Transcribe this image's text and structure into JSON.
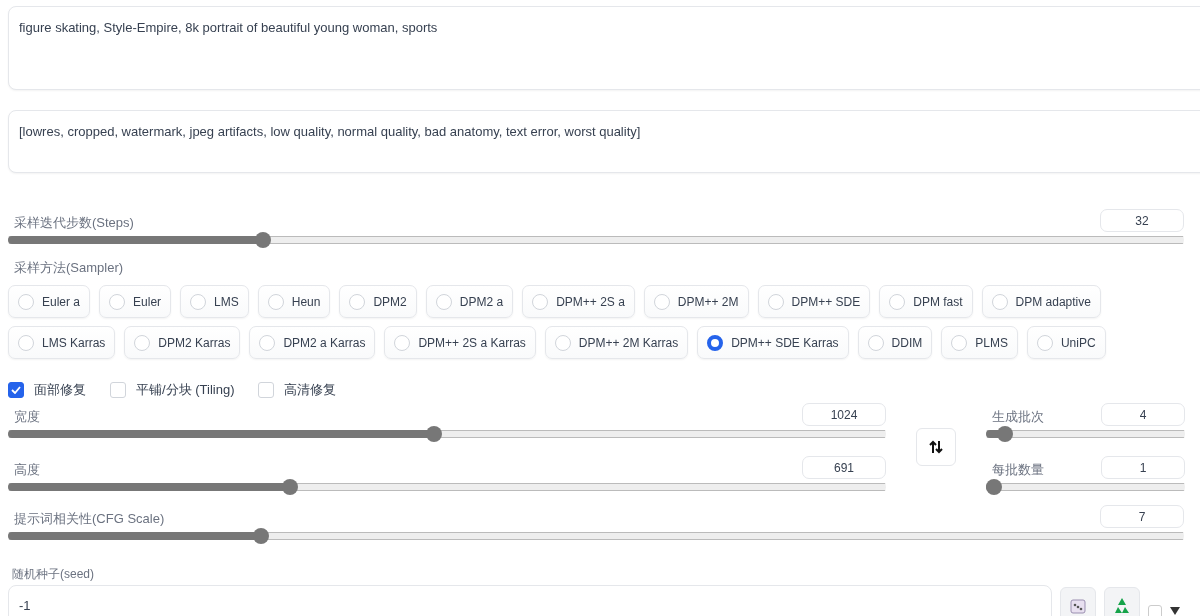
{
  "prompt": {
    "value": "figure skating, Style-Empire, 8k portrait of beautiful young woman, sports"
  },
  "negative_prompt": {
    "value": "[lowres, cropped, watermark, jpeg artifacts, low quality, normal quality, bad anatomy, text error, worst quality]"
  },
  "steps": {
    "label": "采样迭代步数(Steps)",
    "value": "32",
    "level": 0.213
  },
  "sampler": {
    "label": "采样方法(Sampler)",
    "options": [
      {
        "label": "Euler a",
        "selected": false
      },
      {
        "label": "Euler",
        "selected": false
      },
      {
        "label": "LMS",
        "selected": false
      },
      {
        "label": "Heun",
        "selected": false
      },
      {
        "label": "DPM2",
        "selected": false
      },
      {
        "label": "DPM2 a",
        "selected": false
      },
      {
        "label": "DPM++ 2S a",
        "selected": false
      },
      {
        "label": "DPM++ 2M",
        "selected": false
      },
      {
        "label": "DPM++ SDE",
        "selected": false
      },
      {
        "label": "DPM fast",
        "selected": false
      },
      {
        "label": "DPM adaptive",
        "selected": false
      },
      {
        "label": "LMS Karras",
        "selected": false
      },
      {
        "label": "DPM2 Karras",
        "selected": false
      },
      {
        "label": "DPM2 a Karras",
        "selected": false
      },
      {
        "label": "DPM++ 2S a Karras",
        "selected": false
      },
      {
        "label": "DPM++ 2M Karras",
        "selected": false
      },
      {
        "label": "DPM++ SDE Karras",
        "selected": true
      },
      {
        "label": "DDIM",
        "selected": false
      },
      {
        "label": "PLMS",
        "selected": false
      },
      {
        "label": "UniPC",
        "selected": false
      }
    ]
  },
  "options": [
    {
      "label": "面部修复",
      "checked": true
    },
    {
      "label": "平铺/分块 (Tiling)",
      "checked": false
    },
    {
      "label": "高清修复",
      "checked": false
    }
  ],
  "width": {
    "label": "宽度",
    "value": "1024",
    "level": 0.485
  },
  "height": {
    "label": "高度",
    "value": "691",
    "level": 0.318
  },
  "batch_count": {
    "label": "生成批次",
    "value": "4",
    "level": 0.06
  },
  "batch_size": {
    "label": "每批数量",
    "value": "1",
    "level": 0
  },
  "cfg_scale": {
    "label": "提示词相关性(CFG Scale)",
    "value": "7",
    "level": 0.211
  },
  "seed": {
    "label": "随机种子(seed)",
    "value": "-1",
    "extra_checked": false
  }
}
